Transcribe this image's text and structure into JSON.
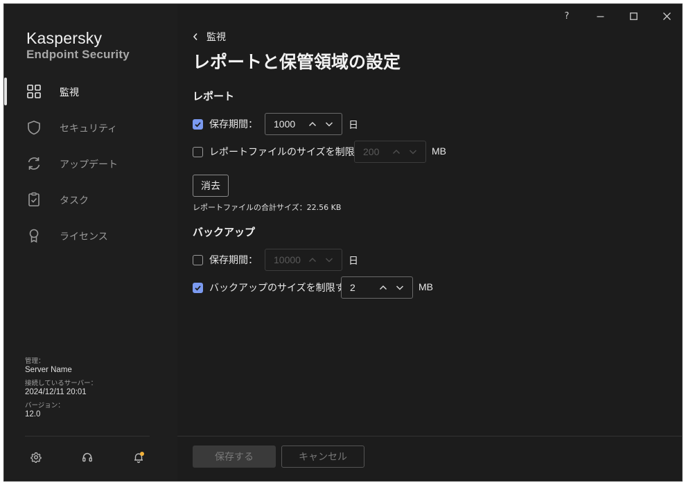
{
  "window": {
    "help_label": "?",
    "minimize_icon": "minimize-icon",
    "maximize_icon": "maximize-icon",
    "close_icon": "close-icon"
  },
  "brand": {
    "line1": "Kaspersky",
    "line2": "Endpoint Security"
  },
  "sidebar": {
    "items": [
      {
        "label": "監視",
        "icon": "dashboard-grid-icon",
        "active": true
      },
      {
        "label": "セキュリティ",
        "icon": "shield-icon",
        "active": false
      },
      {
        "label": "アップデート",
        "icon": "refresh-icon",
        "active": false
      },
      {
        "label": "タスク",
        "icon": "clipboard-icon",
        "active": false
      },
      {
        "label": "ライセンス",
        "icon": "badge-icon",
        "active": false
      }
    ],
    "meta": {
      "admin_key": "管理：",
      "admin_value": "Server Name",
      "server_key": "接続しているサーバー：",
      "server_value": "2024/12/11 20:01",
      "version_key": "バージョン：",
      "version_value": "12.0"
    },
    "footer_icons": [
      "settings-icon",
      "support-headset-icon",
      "notification-bell-icon"
    ],
    "notification_dot_color": "#f2b23a"
  },
  "header": {
    "back_label": "監視",
    "title": "レポートと保管領域の設定"
  },
  "reports": {
    "section_title": "レポート",
    "retention": {
      "checked": true,
      "label": "保存期間：",
      "value": "1000",
      "unit": "日"
    },
    "size_limit": {
      "checked": false,
      "label": "レポートファイルのサイズを制限する：",
      "value": "200",
      "unit": "MB"
    },
    "clear_button": "消去",
    "total_size": "レポートファイルの合計サイズ：22.56 KB"
  },
  "backup": {
    "section_title": "バックアップ",
    "retention": {
      "checked": false,
      "label": "保存期間：",
      "value": "10000",
      "unit": "日"
    },
    "size_limit": {
      "checked": true,
      "label": "バックアップのサイズを制限する：",
      "value": "2",
      "unit": "MB"
    }
  },
  "footer": {
    "save_label": "保存する",
    "cancel_label": "キャンセル"
  },
  "colors": {
    "accent": "#7b9af0",
    "background": "#1c1c1c"
  }
}
